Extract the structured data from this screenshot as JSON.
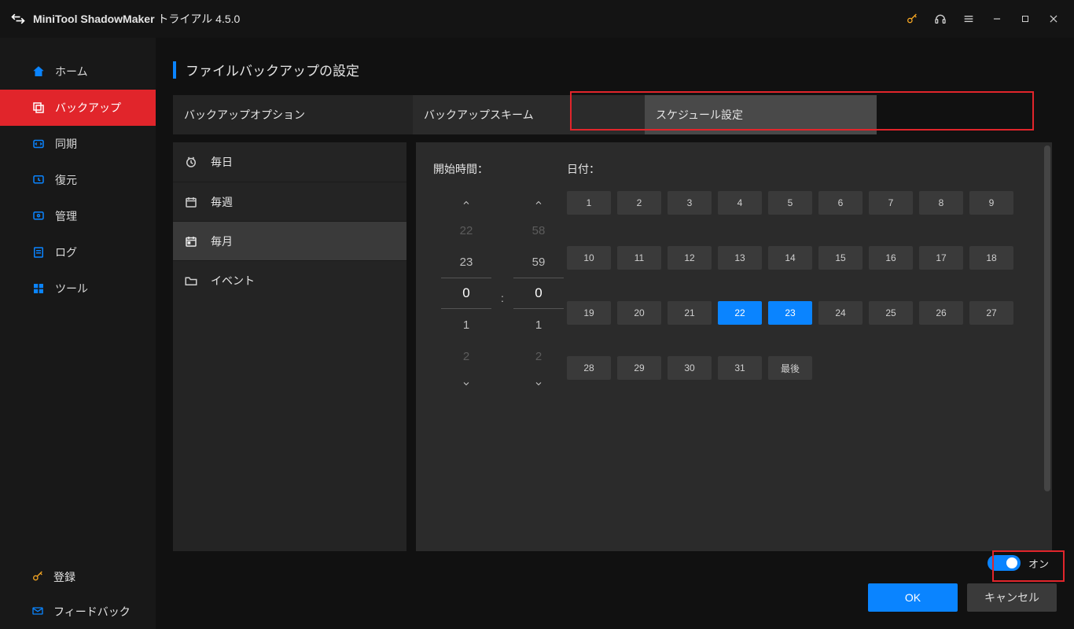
{
  "app": {
    "name_bold": "MiniTool ShadowMaker",
    "name_rest": " トライアル 4.5.0"
  },
  "sidebar": {
    "items": [
      {
        "label": "ホーム"
      },
      {
        "label": "バックアップ"
      },
      {
        "label": "同期"
      },
      {
        "label": "復元"
      },
      {
        "label": "管理"
      },
      {
        "label": "ログ"
      },
      {
        "label": "ツール"
      }
    ],
    "bottom": [
      {
        "label": "登録"
      },
      {
        "label": "フィードバック"
      }
    ]
  },
  "page": {
    "title": "ファイルバックアップの設定"
  },
  "tabs": {
    "options": "バックアップオプション",
    "scheme": "バックアップスキーム",
    "schedule": "スケジュール設定"
  },
  "freq": {
    "daily": "毎日",
    "weekly": "毎週",
    "monthly": "毎月",
    "event": "イベント"
  },
  "schedule": {
    "start_label": "開始時間：",
    "date_label": "日付：",
    "hours": [
      "22",
      "23",
      "0",
      "1",
      "2"
    ],
    "minutes": [
      "58",
      "59",
      "0",
      "1",
      "2"
    ],
    "colon": ":",
    "days": [
      "1",
      "2",
      "3",
      "4",
      "5",
      "6",
      "7",
      "8",
      "9",
      "10",
      "11",
      "12",
      "13",
      "14",
      "15",
      "16",
      "17",
      "18",
      "19",
      "20",
      "21",
      "22",
      "23",
      "24",
      "25",
      "26",
      "27",
      "28",
      "29",
      "30",
      "31"
    ],
    "last_label": "最後",
    "selected_days": [
      "22",
      "23"
    ]
  },
  "footer": {
    "toggle_label": "オン",
    "ok": "OK",
    "cancel": "キャンセル"
  }
}
